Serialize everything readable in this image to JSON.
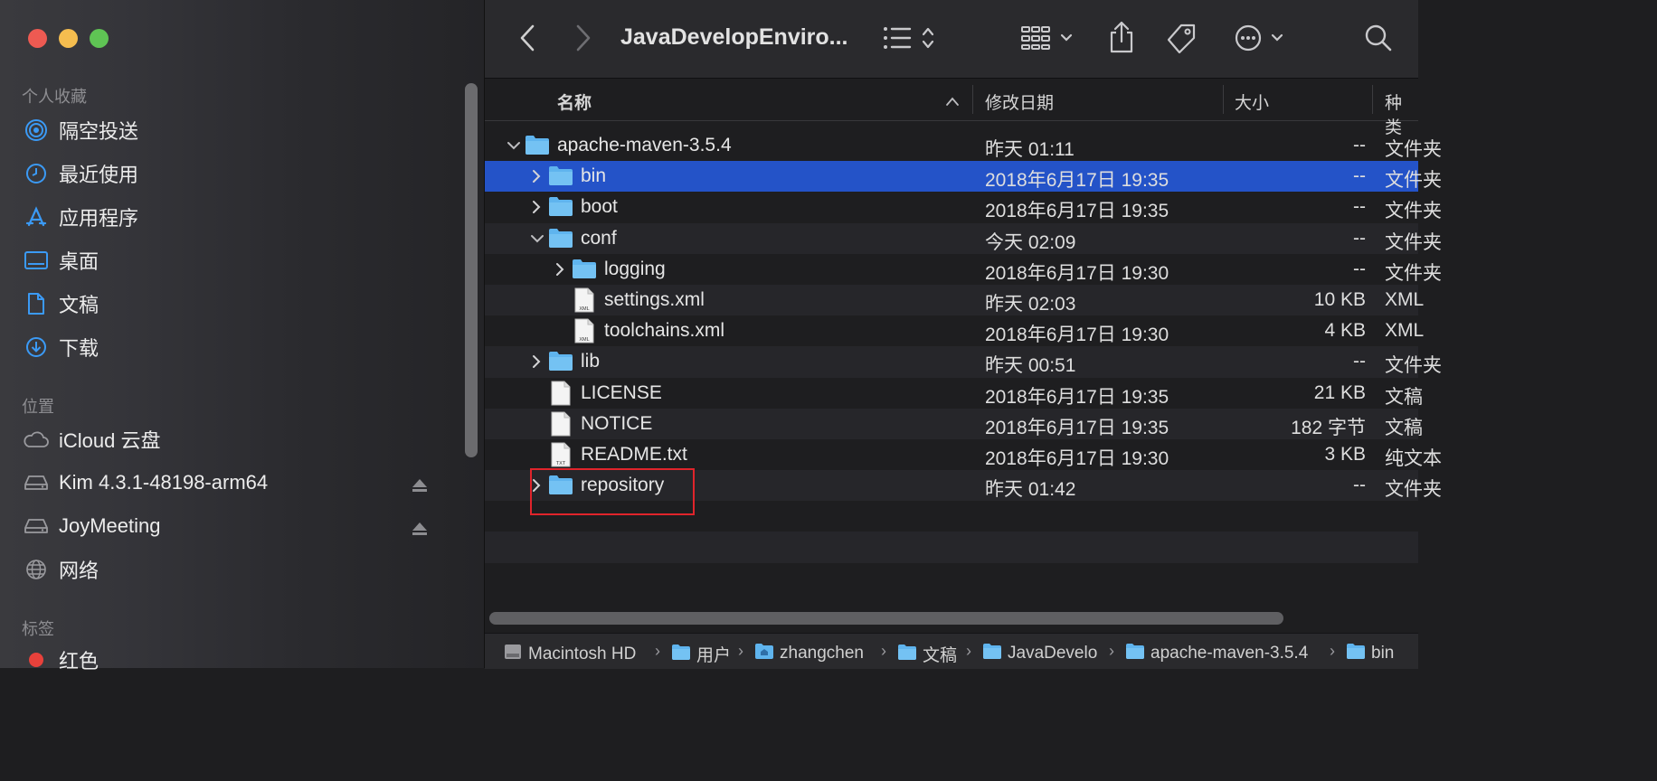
{
  "window": {
    "title": "JavaDevelopEnviro...",
    "traffic_colors": [
      "#ee5a52",
      "#f5bd4f",
      "#5fc454"
    ]
  },
  "sidebar": {
    "favorites_title": "个人收藏",
    "favorites": [
      {
        "label": "隔空投送",
        "icon": "airdrop-icon"
      },
      {
        "label": "最近使用",
        "icon": "clock-icon"
      },
      {
        "label": "应用程序",
        "icon": "applications-icon"
      },
      {
        "label": "桌面",
        "icon": "desktop-icon"
      },
      {
        "label": "文稿",
        "icon": "document-icon"
      },
      {
        "label": "下载",
        "icon": "download-icon"
      }
    ],
    "locations_title": "位置",
    "locations": [
      {
        "label": "iCloud 云盘",
        "icon": "cloud-icon"
      },
      {
        "label": "Kim 4.3.1-48198-arm64",
        "icon": "disk-icon",
        "eject": true
      },
      {
        "label": "JoyMeeting",
        "icon": "disk-icon",
        "eject": true
      },
      {
        "label": "网络",
        "icon": "globe-icon"
      }
    ],
    "tags_title": "标签",
    "tags": [
      {
        "label": "红色",
        "color": "#e8413b"
      }
    ]
  },
  "columns": {
    "name": "名称",
    "date": "修改日期",
    "size": "大小",
    "kind": "种类"
  },
  "files": [
    {
      "name": "apache-maven-3.5.4",
      "date": "昨天 01:11",
      "size": "--",
      "kind": "文件夹",
      "type": "folder",
      "level": 0,
      "expanded": true
    },
    {
      "name": "bin",
      "date": "2018年6月17日 19:35",
      "size": "--",
      "kind": "文件夹",
      "type": "folder",
      "level": 1,
      "expanded": false,
      "selected": true
    },
    {
      "name": "boot",
      "date": "2018年6月17日 19:35",
      "size": "--",
      "kind": "文件夹",
      "type": "folder",
      "level": 1,
      "expanded": false
    },
    {
      "name": "conf",
      "date": "今天 02:09",
      "size": "--",
      "kind": "文件夹",
      "type": "folder",
      "level": 1,
      "expanded": true
    },
    {
      "name": "logging",
      "date": "2018年6月17日 19:30",
      "size": "--",
      "kind": "文件夹",
      "type": "folder",
      "level": 2,
      "expanded": false
    },
    {
      "name": "settings.xml",
      "date": "昨天 02:03",
      "size": "10 KB",
      "kind": "XML",
      "type": "xml",
      "level": 2
    },
    {
      "name": "toolchains.xml",
      "date": "2018年6月17日 19:30",
      "size": "4 KB",
      "kind": "XML",
      "type": "xml",
      "level": 2
    },
    {
      "name": "lib",
      "date": "昨天 00:51",
      "size": "--",
      "kind": "文件夹",
      "type": "folder",
      "level": 1,
      "expanded": false
    },
    {
      "name": "LICENSE",
      "date": "2018年6月17日 19:35",
      "size": "21 KB",
      "kind": "文稿",
      "type": "doc",
      "level": 1
    },
    {
      "name": "NOTICE",
      "date": "2018年6月17日 19:35",
      "size": "182 字节",
      "kind": "文稿",
      "type": "doc",
      "level": 1
    },
    {
      "name": "README.txt",
      "date": "2018年6月17日 19:30",
      "size": "3 KB",
      "kind": "纯文本",
      "type": "txt",
      "level": 1
    },
    {
      "name": "repository",
      "date": "昨天 01:42",
      "size": "--",
      "kind": "文件夹",
      "type": "folder",
      "level": 1,
      "expanded": false
    }
  ],
  "pathbar": [
    {
      "label": "Macintosh HD",
      "icon": "hard-drive-icon"
    },
    {
      "label": "用户",
      "icon": "folder-icon"
    },
    {
      "label": "zhangchen",
      "icon": "home-folder-icon"
    },
    {
      "label": "文稿",
      "icon": "folder-icon"
    },
    {
      "label": "JavaDevelo",
      "icon": "folder-icon"
    },
    {
      "label": "apache-maven-3.5.4",
      "icon": "folder-icon"
    },
    {
      "label": "bin",
      "icon": "folder-icon"
    }
  ],
  "colors": {
    "selection": "#2453c8",
    "folder": "#5fb4ee",
    "highlight_box": "#e0242b",
    "accent": "#3b9af5"
  }
}
